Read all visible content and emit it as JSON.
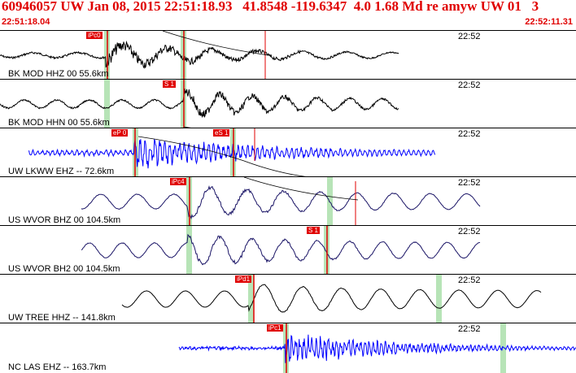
{
  "header": {
    "title": "60946057 UW Jan 08, 2015 22:51:18.93   41.8548 -119.6347  4.0 1.68 Md re amyw UW 01   3",
    "start_time": "22:51:18.04",
    "end_time": "22:52:11.31"
  },
  "colors": {
    "accent": "#e00000",
    "trace_black": "#000000",
    "trace_blue": "#0000ff",
    "trace_navy": "#1a1466",
    "shade": "#b7e4b7"
  },
  "panels": [
    {
      "label": "BK MOD HHZ 00 55.6km",
      "tick": "22:52",
      "trace_color": "#000000",
      "picks": [
        "iPc0"
      ]
    },
    {
      "label": "BK MOD HHN 00 55.6km",
      "tick": "22:52",
      "trace_color": "#000000",
      "picks": [
        "S 1"
      ]
    },
    {
      "label": "UW LKWW EHZ -- 72.6km",
      "tick": "22:52",
      "trace_color": "#0000ff",
      "picks": [
        "eP 0",
        "eS 1"
      ]
    },
    {
      "label": "US WVOR BHZ 00 104.5km",
      "tick": "22:52",
      "trace_color": "#1a1466",
      "picks": [
        "iPc4"
      ]
    },
    {
      "label": "US WVOR BH2 00 104.5km",
      "tick": "22:52",
      "trace_color": "#1a1466",
      "picks": [
        "S 1"
      ]
    },
    {
      "label": "UW TREE HHZ -- 141.8km",
      "tick": "22:52",
      "trace_color": "#000000",
      "picks": [
        "iPd1"
      ]
    },
    {
      "label": "NC LAS EHZ -- 163.7km",
      "tick": "22:52",
      "trace_color": "#0000ff",
      "picks": [
        "iPc1"
      ]
    }
  ]
}
